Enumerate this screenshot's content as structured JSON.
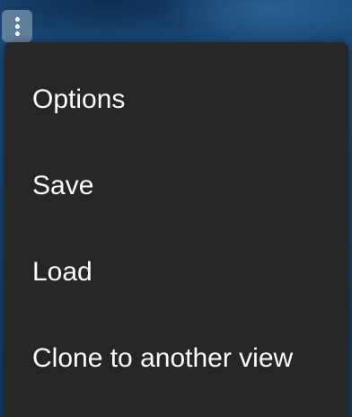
{
  "toolbar": {
    "more_icon": "kebab-vertical-icon"
  },
  "menu": {
    "items": [
      {
        "label": "Options"
      },
      {
        "label": "Save"
      },
      {
        "label": "Load"
      },
      {
        "label": "Clone to another view"
      }
    ]
  },
  "colors": {
    "menu_background": "#262626",
    "menu_text": "#ffffff",
    "button_background": "#5f7e9a",
    "backdrop": "#123a63"
  }
}
